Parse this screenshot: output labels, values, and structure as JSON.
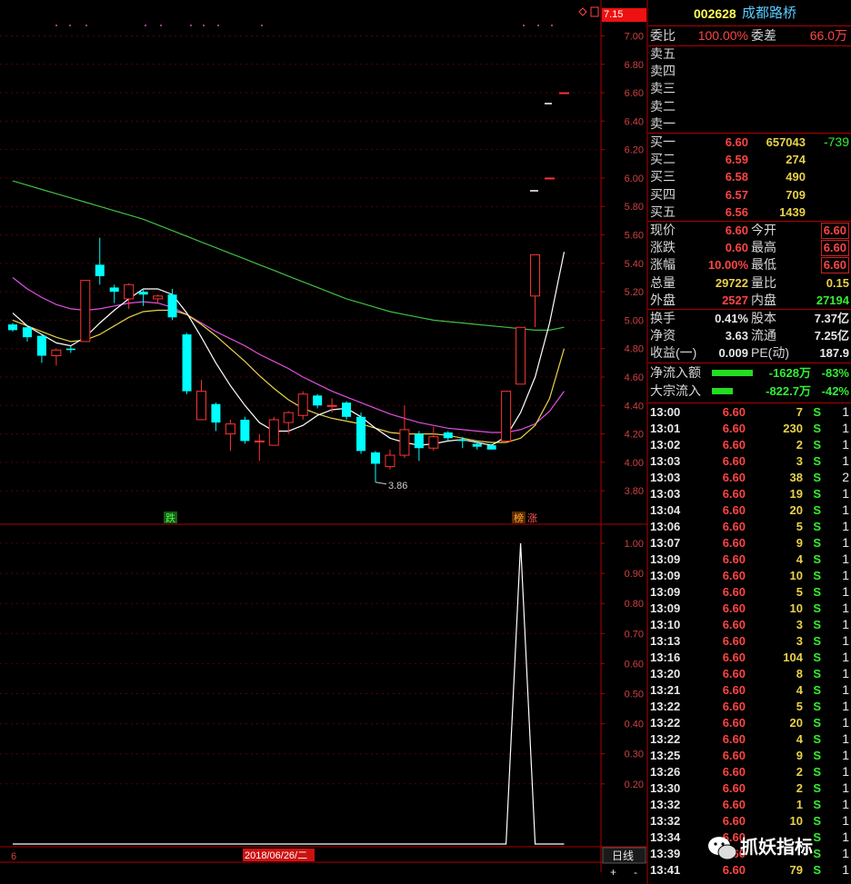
{
  "header": {
    "code": "002628",
    "name": "成都路桥"
  },
  "current_price_tag": "7.15",
  "weibi": {
    "label": "委比",
    "value": "100.00%",
    "label2": "委差",
    "value2": "66.0万"
  },
  "sell": [
    {
      "label": "卖五"
    },
    {
      "label": "卖四"
    },
    {
      "label": "卖三"
    },
    {
      "label": "卖二"
    },
    {
      "label": "卖一"
    }
  ],
  "buy": [
    {
      "label": "买一",
      "price": "6.60",
      "vol": "657043",
      "chg": "-739"
    },
    {
      "label": "买二",
      "price": "6.59",
      "vol": "274",
      "chg": ""
    },
    {
      "label": "买三",
      "price": "6.58",
      "vol": "490",
      "chg": ""
    },
    {
      "label": "买四",
      "price": "6.57",
      "vol": "709",
      "chg": ""
    },
    {
      "label": "买五",
      "price": "6.56",
      "vol": "1439",
      "chg": ""
    }
  ],
  "quote": [
    {
      "l1": "现价",
      "v1": "6.60",
      "l2": "今开",
      "v2": "6.60"
    },
    {
      "l1": "涨跌",
      "v1": "0.60",
      "l2": "最高",
      "v2": "6.60"
    },
    {
      "l1": "涨幅",
      "v1": "10.00%",
      "l2": "最低",
      "v2": "6.60"
    },
    {
      "l1": "总量",
      "v1": "29722",
      "l2": "量比",
      "v2": "0.15"
    },
    {
      "l1": "外盘",
      "v1": "2527",
      "l2": "内盘",
      "v2": "27194"
    }
  ],
  "fund": [
    {
      "l1": "换手",
      "v1": "0.41%",
      "l2": "股本",
      "v2": "7.37亿"
    },
    {
      "l1": "净资",
      "v1": "3.63",
      "l2": "流通",
      "v2": "7.25亿"
    },
    {
      "l1": "收益(一)",
      "v1": "0.009",
      "l2": "PE(动)",
      "v2": "187.9"
    }
  ],
  "flow": [
    {
      "label": "净流入额",
      "value": "-1628万",
      "pct": "-83%",
      "bar": 0.83
    },
    {
      "label": "大宗流入",
      "value": "-822.7万",
      "pct": "-42%",
      "bar": 0.42
    }
  ],
  "ticks": [
    {
      "t": "13:00",
      "p": "6.60",
      "v": "7",
      "s": "S",
      "n": "1"
    },
    {
      "t": "13:01",
      "p": "6.60",
      "v": "230",
      "s": "S",
      "n": "1"
    },
    {
      "t": "13:02",
      "p": "6.60",
      "v": "2",
      "s": "S",
      "n": "1"
    },
    {
      "t": "13:03",
      "p": "6.60",
      "v": "3",
      "s": "S",
      "n": "1"
    },
    {
      "t": "13:03",
      "p": "6.60",
      "v": "38",
      "s": "S",
      "n": "2"
    },
    {
      "t": "13:03",
      "p": "6.60",
      "v": "19",
      "s": "S",
      "n": "1"
    },
    {
      "t": "13:04",
      "p": "6.60",
      "v": "20",
      "s": "S",
      "n": "1"
    },
    {
      "t": "13:06",
      "p": "6.60",
      "v": "5",
      "s": "S",
      "n": "1"
    },
    {
      "t": "13:07",
      "p": "6.60",
      "v": "9",
      "s": "S",
      "n": "1"
    },
    {
      "t": "13:09",
      "p": "6.60",
      "v": "4",
      "s": "S",
      "n": "1"
    },
    {
      "t": "13:09",
      "p": "6.60",
      "v": "10",
      "s": "S",
      "n": "1"
    },
    {
      "t": "13:09",
      "p": "6.60",
      "v": "5",
      "s": "S",
      "n": "1"
    },
    {
      "t": "13:09",
      "p": "6.60",
      "v": "10",
      "s": "S",
      "n": "1"
    },
    {
      "t": "13:10",
      "p": "6.60",
      "v": "3",
      "s": "S",
      "n": "1"
    },
    {
      "t": "13:13",
      "p": "6.60",
      "v": "3",
      "s": "S",
      "n": "1"
    },
    {
      "t": "13:16",
      "p": "6.60",
      "v": "104",
      "s": "S",
      "n": "1"
    },
    {
      "t": "13:20",
      "p": "6.60",
      "v": "8",
      "s": "S",
      "n": "1"
    },
    {
      "t": "13:21",
      "p": "6.60",
      "v": "4",
      "s": "S",
      "n": "1"
    },
    {
      "t": "13:22",
      "p": "6.60",
      "v": "5",
      "s": "S",
      "n": "1"
    },
    {
      "t": "13:22",
      "p": "6.60",
      "v": "20",
      "s": "S",
      "n": "1"
    },
    {
      "t": "13:22",
      "p": "6.60",
      "v": "4",
      "s": "S",
      "n": "1"
    },
    {
      "t": "13:25",
      "p": "6.60",
      "v": "9",
      "s": "S",
      "n": "1"
    },
    {
      "t": "13:26",
      "p": "6.60",
      "v": "2",
      "s": "S",
      "n": "1"
    },
    {
      "t": "13:30",
      "p": "6.60",
      "v": "2",
      "s": "S",
      "n": "1"
    },
    {
      "t": "13:32",
      "p": "6.60",
      "v": "1",
      "s": "S",
      "n": "1"
    },
    {
      "t": "13:32",
      "p": "6.60",
      "v": "10",
      "s": "S",
      "n": "1"
    },
    {
      "t": "13:34",
      "p": "6.60",
      "v": "",
      "s": "S",
      "n": "1"
    },
    {
      "t": "13:39",
      "p": "6.60",
      "v": "",
      "s": "S",
      "n": "1"
    },
    {
      "t": "13:41",
      "p": "6.60",
      "v": "79",
      "s": "S",
      "n": "1"
    }
  ],
  "watermark": "抓妖指标",
  "bottom_bar": {
    "left_label": "6",
    "date_label": "2018/06/26/二",
    "period": "日线",
    "plus": "+",
    "minus": "-"
  },
  "markers": {
    "low_price": "3.86",
    "die": "跌",
    "bang": "榜",
    "zhang": "涨"
  },
  "colors": {
    "up": "#ff3333",
    "down": "#00ffff",
    "ma5": "#ffffff",
    "ma10": "#e8d24a",
    "ma20": "#e050e0",
    "ma60": "#40c040",
    "border": "#b00000"
  },
  "chart_data": [
    {
      "type": "candlestick",
      "price_axis_ticks": [
        "7.00",
        "6.80",
        "6.60",
        "6.40",
        "6.20",
        "6.00",
        "5.80",
        "5.60",
        "5.40",
        "5.20",
        "5.00",
        "4.80",
        "4.60",
        "4.40",
        "4.20",
        "4.00",
        "3.80"
      ],
      "ylim": [
        3.75,
        7.15
      ],
      "candles": [
        {
          "o": 4.97,
          "h": 4.98,
          "l": 4.92,
          "c": 4.93
        },
        {
          "o": 4.95,
          "h": 4.96,
          "l": 4.85,
          "c": 4.88
        },
        {
          "o": 4.89,
          "h": 4.9,
          "l": 4.7,
          "c": 4.75
        },
        {
          "o": 4.75,
          "h": 4.8,
          "l": 4.68,
          "c": 4.79
        },
        {
          "o": 4.8,
          "h": 4.82,
          "l": 4.77,
          "c": 4.79
        },
        {
          "o": 4.85,
          "h": 5.28,
          "l": 4.85,
          "c": 5.28
        },
        {
          "o": 5.39,
          "h": 5.58,
          "l": 5.25,
          "c": 5.31
        },
        {
          "o": 5.23,
          "h": 5.25,
          "l": 5.12,
          "c": 5.2
        },
        {
          "o": 5.15,
          "h": 5.26,
          "l": 5.08,
          "c": 5.25
        },
        {
          "o": 5.2,
          "h": 5.22,
          "l": 5.1,
          "c": 5.18
        },
        {
          "o": 5.15,
          "h": 5.18,
          "l": 5.12,
          "c": 5.17
        },
        {
          "o": 5.18,
          "h": 5.22,
          "l": 5.0,
          "c": 5.02
        },
        {
          "o": 4.9,
          "h": 4.91,
          "l": 4.48,
          "c": 4.5
        },
        {
          "o": 4.3,
          "h": 4.58,
          "l": 4.3,
          "c": 4.5
        },
        {
          "o": 4.41,
          "h": 4.42,
          "l": 4.22,
          "c": 4.28
        },
        {
          "o": 4.2,
          "h": 4.3,
          "l": 4.08,
          "c": 4.27
        },
        {
          "o": 4.3,
          "h": 4.32,
          "l": 4.13,
          "c": 4.15
        },
        {
          "o": 4.15,
          "h": 4.2,
          "l": 4.01,
          "c": 4.15
        },
        {
          "o": 4.12,
          "h": 4.32,
          "l": 4.12,
          "c": 4.3
        },
        {
          "o": 4.28,
          "h": 4.36,
          "l": 4.2,
          "c": 4.35
        },
        {
          "o": 4.33,
          "h": 4.5,
          "l": 4.3,
          "c": 4.48
        },
        {
          "o": 4.47,
          "h": 4.48,
          "l": 4.38,
          "c": 4.4
        },
        {
          "o": 4.4,
          "h": 4.45,
          "l": 4.35,
          "c": 4.4
        },
        {
          "o": 4.42,
          "h": 4.43,
          "l": 4.3,
          "c": 4.32
        },
        {
          "o": 4.32,
          "h": 4.35,
          "l": 4.06,
          "c": 4.08
        },
        {
          "o": 4.07,
          "h": 4.08,
          "l": 3.86,
          "c": 3.99
        },
        {
          "o": 3.97,
          "h": 4.09,
          "l": 3.95,
          "c": 4.05
        },
        {
          "o": 4.05,
          "h": 4.4,
          "l": 4.03,
          "c": 4.23
        },
        {
          "o": 4.2,
          "h": 4.22,
          "l": 4.01,
          "c": 4.1
        },
        {
          "o": 4.1,
          "h": 4.25,
          "l": 4.08,
          "c": 4.18
        },
        {
          "o": 4.21,
          "h": 4.22,
          "l": 4.15,
          "c": 4.17
        },
        {
          "o": 4.16,
          "h": 4.18,
          "l": 4.1,
          "c": 4.15
        },
        {
          "o": 4.13,
          "h": 4.15,
          "l": 4.09,
          "c": 4.11
        },
        {
          "o": 4.12,
          "h": 4.13,
          "l": 4.09,
          "c": 4.09
        },
        {
          "o": 4.15,
          "h": 4.5,
          "l": 4.15,
          "c": 4.5
        },
        {
          "o": 4.55,
          "h": 4.95,
          "l": 4.55,
          "c": 4.95
        },
        {
          "o": 5.17,
          "h": 5.46,
          "l": 4.95,
          "c": 5.46
        },
        {
          "o": 6.0,
          "h": 6.0,
          "l": 6.0,
          "c": 6.0
        },
        {
          "o": 6.6,
          "h": 6.6,
          "l": 6.6,
          "c": 6.6
        }
      ],
      "ma5": [
        5.05,
        4.96,
        4.9,
        4.84,
        4.82,
        4.88,
        4.98,
        5.07,
        5.15,
        5.22,
        5.22,
        5.18,
        5.05,
        4.88,
        4.7,
        4.54,
        4.4,
        4.28,
        4.22,
        4.22,
        4.26,
        4.33,
        4.37,
        4.38,
        4.32,
        4.24,
        4.17,
        4.14,
        4.12,
        4.13,
        4.15,
        4.16,
        4.14,
        4.12,
        4.18,
        4.35,
        4.6,
        4.98,
        5.48
      ],
      "ma10": [
        5.0,
        4.96,
        4.92,
        4.88,
        4.85,
        4.86,
        4.9,
        4.96,
        5.02,
        5.06,
        5.07,
        5.07,
        5.04,
        4.97,
        4.89,
        4.8,
        4.71,
        4.61,
        4.52,
        4.44,
        4.38,
        4.34,
        4.31,
        4.29,
        4.27,
        4.24,
        4.21,
        4.2,
        4.2,
        4.2,
        4.19,
        4.17,
        4.15,
        4.14,
        4.14,
        4.17,
        4.26,
        4.45,
        4.8
      ],
      "ma20": [
        5.3,
        5.22,
        5.16,
        5.11,
        5.08,
        5.07,
        5.08,
        5.1,
        5.12,
        5.13,
        5.12,
        5.09,
        5.04,
        4.98,
        4.92,
        4.87,
        4.82,
        4.76,
        4.71,
        4.66,
        4.6,
        4.55,
        4.5,
        4.46,
        4.42,
        4.38,
        4.34,
        4.31,
        4.28,
        4.26,
        4.24,
        4.23,
        4.22,
        4.21,
        4.21,
        4.23,
        4.27,
        4.36,
        4.5
      ],
      "ma60": [
        5.98,
        5.95,
        5.92,
        5.89,
        5.86,
        5.83,
        5.8,
        5.77,
        5.74,
        5.71,
        5.67,
        5.63,
        5.59,
        5.55,
        5.51,
        5.47,
        5.43,
        5.39,
        5.35,
        5.31,
        5.27,
        5.23,
        5.19,
        5.15,
        5.12,
        5.09,
        5.06,
        5.04,
        5.02,
        5.0,
        4.99,
        4.98,
        4.97,
        4.96,
        4.95,
        4.94,
        4.93,
        4.93,
        4.95
      ]
    },
    {
      "type": "line",
      "y_axis_ticks": [
        "1.00",
        "0.90",
        "0.80",
        "0.70",
        "0.60",
        "0.50",
        "0.40",
        "0.30",
        "0.20"
      ],
      "ylim": [
        -0.02,
        1.05
      ],
      "values": [
        0,
        0,
        0,
        0,
        0,
        0,
        0,
        0,
        0,
        0,
        0,
        0,
        0,
        0,
        0,
        0,
        0,
        0,
        0,
        0,
        0,
        0,
        0,
        0,
        0,
        0,
        0,
        0,
        0,
        0,
        0,
        0,
        0,
        0,
        0,
        1,
        0,
        0,
        0
      ]
    }
  ]
}
